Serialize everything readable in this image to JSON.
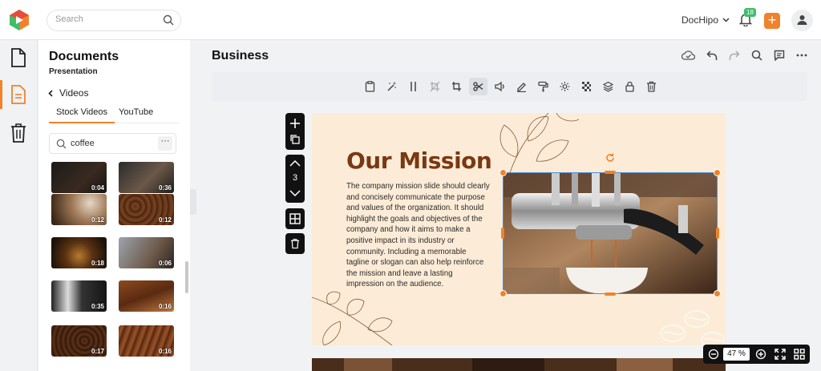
{
  "header": {
    "search_placeholder": "Search",
    "brand_label": "DocHipo",
    "notification_count": "18",
    "add_label": "+"
  },
  "colors": {
    "accent": "#f0822c",
    "badge": "#3fbe6a",
    "heading": "#7a3813",
    "slide_bg": "#fcecd7",
    "selection": "#4c8fd1"
  },
  "rail": {
    "items": [
      {
        "icon": "document-icon"
      },
      {
        "icon": "page-icon",
        "active": true
      },
      {
        "icon": "trash-icon"
      }
    ]
  },
  "panel": {
    "title": "Documents",
    "subtitle": "Presentation",
    "back_label": "Videos",
    "tabs": [
      {
        "label": "Stock Videos",
        "active": true
      },
      {
        "label": "YouTube",
        "active": false
      }
    ],
    "search_value": "coffee",
    "more_label": "···",
    "videos": [
      {
        "duration": "0:04"
      },
      {
        "duration": "0:36"
      },
      {
        "duration": "0:12"
      },
      {
        "duration": "0:12"
      },
      {
        "duration": "0:18"
      },
      {
        "duration": "0:06"
      },
      {
        "duration": "0:35"
      },
      {
        "duration": "0:16"
      },
      {
        "duration": "0:17"
      },
      {
        "duration": "0:16"
      }
    ]
  },
  "workspace": {
    "title": "Business",
    "page_number": "3",
    "toolbar_icons": [
      "clipboard-icon",
      "magic-wand-icon",
      "split-icon",
      "no-crop-icon",
      "crop-icon",
      "scissors-icon",
      "volume-icon",
      "pen-icon",
      "paint-roller-icon",
      "brightness-icon",
      "transparency-icon",
      "layers-icon",
      "lock-icon",
      "delete-icon"
    ],
    "header_icons": [
      "cloud-icon",
      "undo-icon",
      "redo-icon",
      "search-icon",
      "comment-icon",
      "more-icon"
    ]
  },
  "slide": {
    "heading": "Our Mission",
    "body": "The company mission slide should clearly and concisely communicate the purpose and values of the organization. It should highlight the goals and objectives of the company and how it aims to make a positive impact in its industry or community. Including a memorable tagline or slogan can also help reinforce the mission and leave a lasting impression on the audience."
  },
  "zoom": {
    "value": "47 %"
  }
}
